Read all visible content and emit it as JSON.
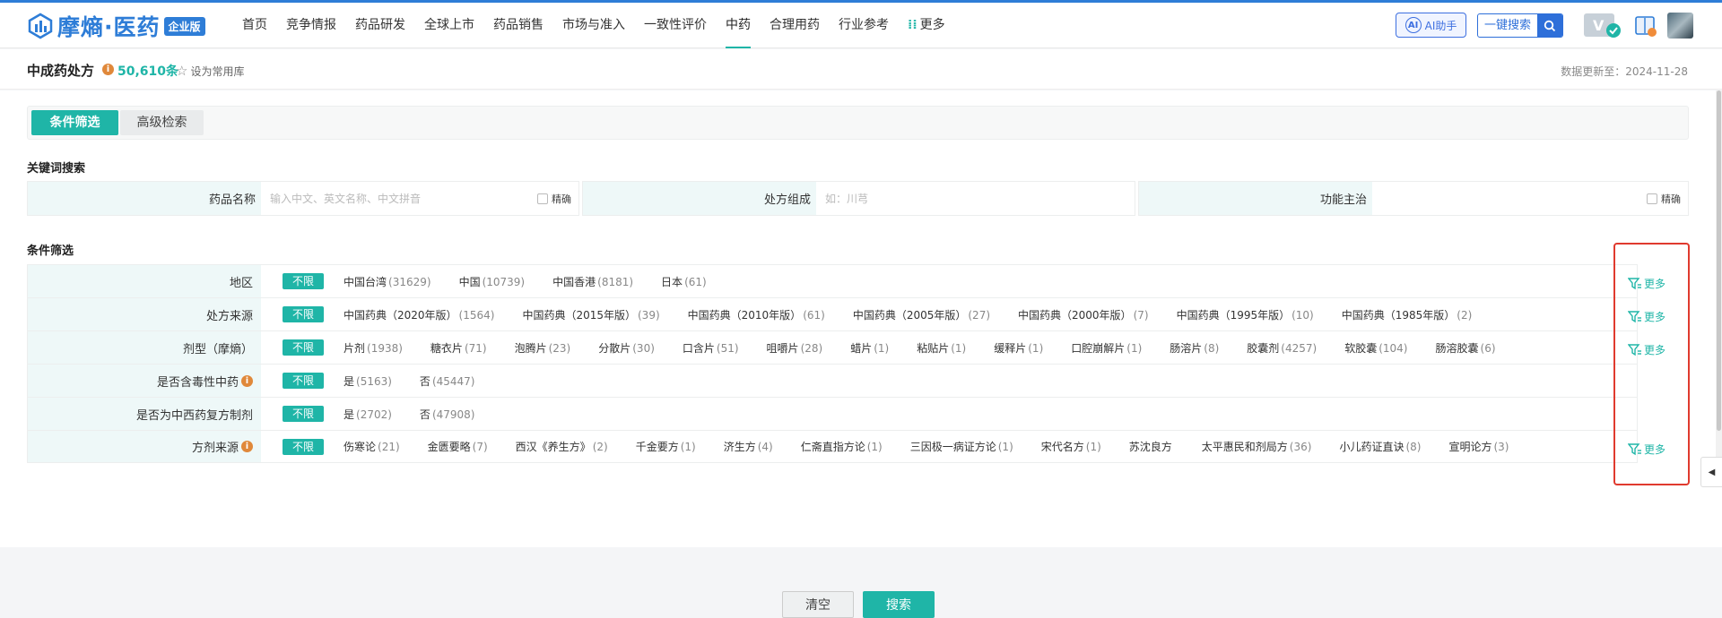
{
  "brand": {
    "name": "摩熵·医药",
    "edition": "企业版"
  },
  "nav": {
    "items": [
      "首页",
      "竞争情报",
      "药品研发",
      "全球上市",
      "药品销售",
      "市场与准入",
      "一致性评价",
      "中药",
      "合理用药",
      "行业参考",
      "更多"
    ],
    "active": "中药",
    "ai_label": "AI助手",
    "ai_badge": "AI",
    "quick_search": "一键搜索"
  },
  "header": {
    "title": "中成药处方",
    "count": "50,610条",
    "favorite": "设为常用库",
    "update": "数据更新至：2024-11-28"
  },
  "tabs": [
    "条件筛选",
    "高级检索"
  ],
  "keyword": {
    "title": "关键词搜索",
    "drug_name_label": "药品名称",
    "drug_name_placeholder": "输入中文、英文名称、中文拼音",
    "exact1": "精确",
    "composition_label": "处方组成",
    "composition_placeholder": "如：川芎",
    "function_label": "功能主治",
    "exact2": "精确"
  },
  "filters": {
    "title": "条件筛选",
    "unlimited": "不限",
    "more": "更多",
    "rows": [
      {
        "label": "地区",
        "info": false,
        "options": [
          {
            "name": "中国台湾",
            "count": "(31629)"
          },
          {
            "name": "中国",
            "count": "(10739)"
          },
          {
            "name": "中国香港",
            "count": "(8181)"
          },
          {
            "name": "日本",
            "count": "(61)"
          }
        ]
      },
      {
        "label": "处方来源",
        "info": false,
        "options": [
          {
            "name": "中国药典（2020年版）",
            "count": "(1564)"
          },
          {
            "name": "中国药典（2015年版）",
            "count": "(39)"
          },
          {
            "name": "中国药典（2010年版）",
            "count": "(61)"
          },
          {
            "name": "中国药典（2005年版）",
            "count": "(27)"
          },
          {
            "name": "中国药典（2000年版）",
            "count": "(7)"
          },
          {
            "name": "中国药典（1995年版）",
            "count": "(10)"
          },
          {
            "name": "中国药典（1985年版）",
            "count": "(2)"
          }
        ]
      },
      {
        "label": "剂型（摩熵）",
        "info": false,
        "options": [
          {
            "name": "片剂",
            "count": "(1938)"
          },
          {
            "name": "糖衣片",
            "count": "(71)"
          },
          {
            "name": "泡腾片",
            "count": "(23)"
          },
          {
            "name": "分散片",
            "count": "(30)"
          },
          {
            "name": "口含片",
            "count": "(51)"
          },
          {
            "name": "咀嚼片",
            "count": "(28)"
          },
          {
            "name": "蜡片",
            "count": "(1)"
          },
          {
            "name": "粘贴片",
            "count": "(1)"
          },
          {
            "name": "缓释片",
            "count": "(1)"
          },
          {
            "name": "口腔崩解片",
            "count": "(1)"
          },
          {
            "name": "肠溶片",
            "count": "(8)"
          },
          {
            "name": "胶囊剂",
            "count": "(4257)"
          },
          {
            "name": "软胶囊",
            "count": "(104)"
          },
          {
            "name": "肠溶胶囊",
            "count": "(6)"
          }
        ]
      },
      {
        "label": "是否含毒性中药",
        "info": true,
        "options": [
          {
            "name": "是",
            "count": "(5163)"
          },
          {
            "name": "否",
            "count": "(45447)"
          }
        ]
      },
      {
        "label": "是否为中西药复方制剂",
        "info": false,
        "options": [
          {
            "name": "是",
            "count": "(2702)"
          },
          {
            "name": "否",
            "count": "(47908)"
          }
        ]
      },
      {
        "label": "方剂来源",
        "info": true,
        "options": [
          {
            "name": "伤寒论",
            "count": "(21)"
          },
          {
            "name": "金匮要略",
            "count": "(7)"
          },
          {
            "name": "西汉《养生方》",
            "count": "(2)"
          },
          {
            "name": "千金要方",
            "count": "(1)"
          },
          {
            "name": "济生方",
            "count": "(4)"
          },
          {
            "name": "仁斋直指方论",
            "count": "(1)"
          },
          {
            "name": "三因极一病证方论",
            "count": "(1)"
          },
          {
            "name": "宋代名方",
            "count": "(1)"
          },
          {
            "name": "苏沈良方",
            "count": ""
          },
          {
            "name": "太平惠民和剂局方",
            "count": "(36)"
          },
          {
            "name": "小儿药证直诀",
            "count": "(8)"
          },
          {
            "name": "宣明论方",
            "count": "(3)"
          }
        ]
      }
    ]
  },
  "actions": {
    "clear": "清空",
    "search": "搜索"
  },
  "colors": {
    "accent": "#1fb5a7",
    "brand": "#2e7dd7",
    "highlight": "#e03a2e"
  }
}
